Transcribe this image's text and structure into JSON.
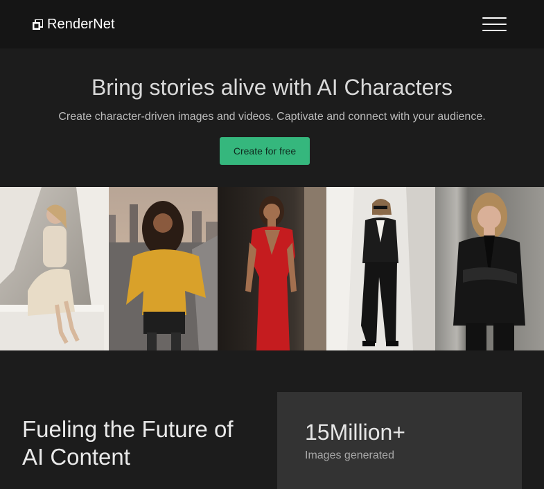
{
  "header": {
    "brand_name": "RenderNet",
    "menu_icon": "hamburger-menu-icon"
  },
  "hero": {
    "title": "Bring stories alive with AI Characters",
    "subtitle": "Create character-driven images and videos. Captivate and connect with your audience.",
    "cta_label": "Create for free"
  },
  "colors": {
    "accent": "#35b77d",
    "background": "#1c1c1c",
    "header_background": "#151515",
    "card_background": "#333333"
  },
  "stats": {
    "heading": "Fueling the Future of AI Content",
    "cards": [
      {
        "value": "15Million+",
        "label": "Images generated"
      }
    ]
  }
}
